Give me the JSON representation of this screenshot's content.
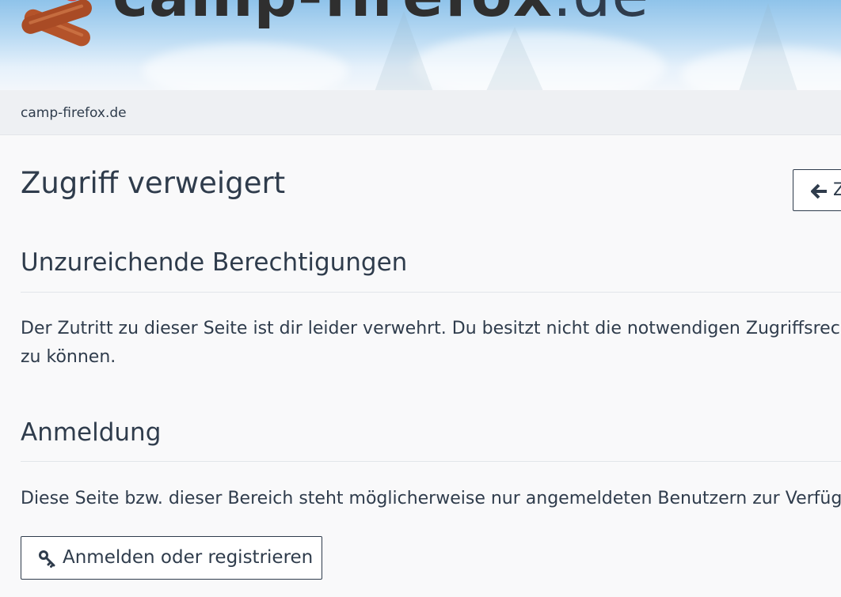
{
  "header": {
    "brand_name": "camp-firefox",
    "brand_tld": ".de"
  },
  "breadcrumb": {
    "home_label": "camp-firefox.de"
  },
  "main": {
    "title": "Zugriff verweigert",
    "back_button_label": "Z",
    "sections": [
      {
        "heading": "Unzureichende Berechtigungen",
        "text_lines": [
          "Der Zutritt zu dieser Seite ist dir leider verwehrt. Du besitzt nicht die notwendigen Zugriffsrech",
          "zu können."
        ]
      },
      {
        "heading": "Anmeldung",
        "text_lines": [
          "Diese Seite bzw. dieser Bereich steht möglicherweise nur angemeldeten Benutzern zur Verfüg"
        ]
      }
    ],
    "login_button_label": "Anmelden oder registrieren"
  },
  "icons": {
    "logo": "campfire-logs-icon",
    "back": "arrow-left-icon",
    "login": "key-icon"
  },
  "colors": {
    "text": "#2f3c4c",
    "logo_wood": "#b4532a",
    "logo_flame": "#e03a2f",
    "breadcrumb_bg": "#eef0f3",
    "page_bg": "#f9f9fa"
  }
}
